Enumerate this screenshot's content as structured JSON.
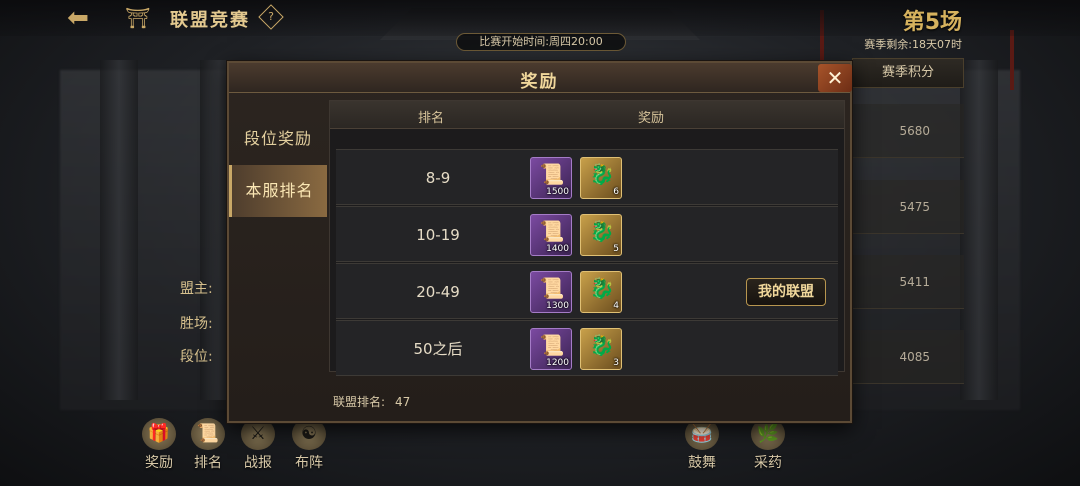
{
  "header": {
    "title": "联盟竞赛",
    "help_symbol": "?",
    "round_label": "第5场",
    "season_remaining": "赛季剩余:18天07时",
    "start_time": "比赛开始时间:周四20:00"
  },
  "background": {
    "score_header": "赛季积分",
    "scores": [
      "5680",
      "5475",
      "5411",
      "4085"
    ],
    "info_labels": [
      "盟主:",
      "胜场:",
      "段位:"
    ]
  },
  "bottom_bar": {
    "buttons": [
      {
        "label": "奖励",
        "icon": "reward-icon"
      },
      {
        "label": "排名",
        "icon": "scroll-icon"
      },
      {
        "label": "战报",
        "icon": "swords-icon"
      },
      {
        "label": "布阵",
        "icon": "formation-icon"
      },
      {
        "label": "鼓舞",
        "icon": "drum-icon"
      },
      {
        "label": "采药",
        "icon": "herb-icon"
      }
    ]
  },
  "modal": {
    "title": "奖励",
    "close_symbol": "✕",
    "tabs": [
      {
        "label": "段位奖励",
        "active": false
      },
      {
        "label": "本服排名",
        "active": true
      }
    ],
    "table": {
      "col_rank": "排名",
      "col_reward": "奖励",
      "rows": [
        {
          "rank": "8-9",
          "rewards": [
            {
              "type": "purple",
              "icon": "order-scroll-icon",
              "qty": "1500"
            },
            {
              "type": "gold",
              "icon": "qilin-statue-icon",
              "qty": "6"
            }
          ],
          "my_alliance": false
        },
        {
          "rank": "10-19",
          "rewards": [
            {
              "type": "purple",
              "icon": "order-scroll-icon",
              "qty": "1400"
            },
            {
              "type": "gold",
              "icon": "qilin-statue-icon",
              "qty": "5"
            }
          ],
          "my_alliance": false
        },
        {
          "rank": "20-49",
          "rewards": [
            {
              "type": "purple",
              "icon": "order-scroll-icon",
              "qty": "1300"
            },
            {
              "type": "gold",
              "icon": "qilin-statue-icon",
              "qty": "4"
            }
          ],
          "my_alliance": true
        },
        {
          "rank": "50之后",
          "rewards": [
            {
              "type": "purple",
              "icon": "order-scroll-icon",
              "qty": "1200"
            },
            {
              "type": "gold",
              "icon": "qilin-statue-icon",
              "qty": "3"
            }
          ],
          "my_alliance": false
        }
      ],
      "my_alliance_label": "我的联盟"
    },
    "alliance_rank_label": "联盟排名:",
    "alliance_rank_value": "47"
  },
  "colors": {
    "accent_gold": "#c9a867",
    "title_gold": "#f0d79b",
    "close_red": "#a7542a",
    "purple_item": "#7b4aa1"
  }
}
